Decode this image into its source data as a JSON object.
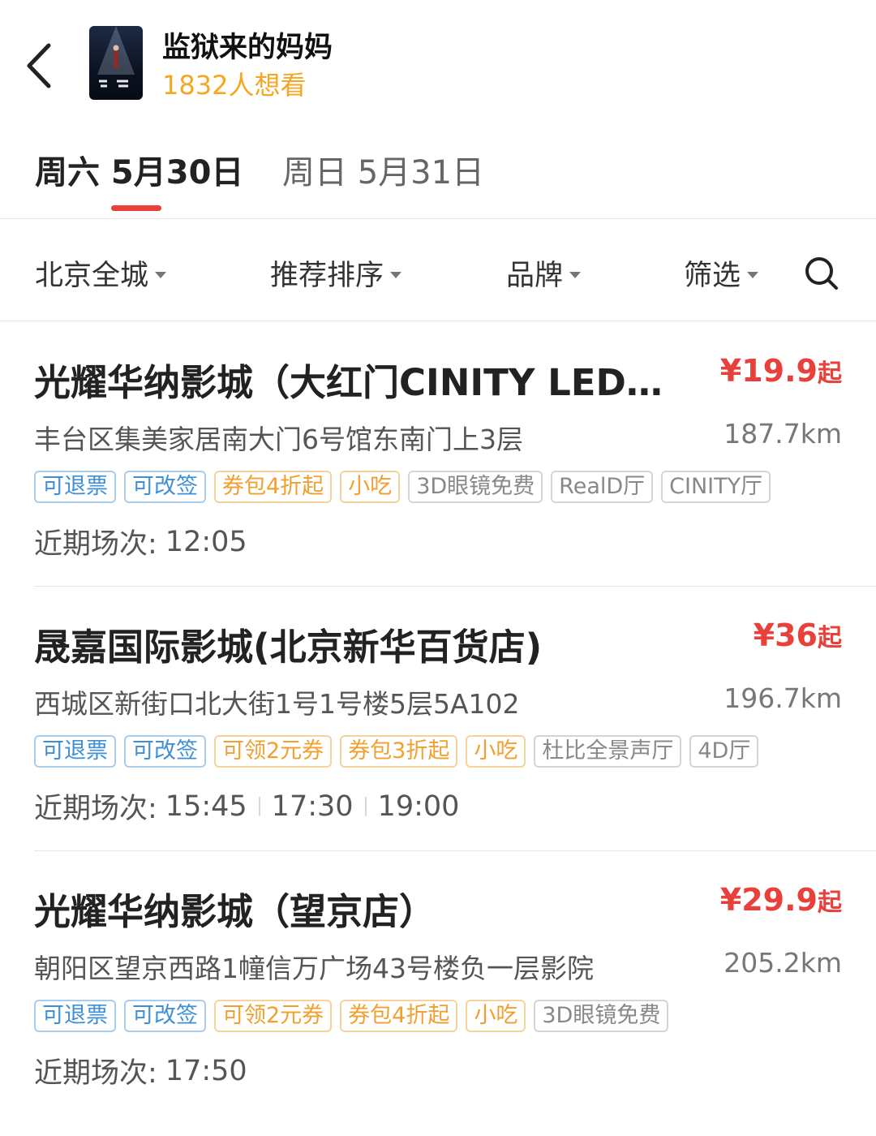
{
  "header": {
    "back_icon": "chevron-left-icon",
    "movie_title": "监狱来的妈妈",
    "want_count": "1832人想看"
  },
  "date_tabs": [
    {
      "label": "周六 5月30日",
      "active": true
    },
    {
      "label": "周日 5月31日",
      "active": false
    }
  ],
  "filters": {
    "city": "北京全城",
    "sort": "推荐排序",
    "brand": "品牌",
    "filter": "筛选",
    "search_icon": "search-icon"
  },
  "colors": {
    "accent_red": "#e8403a",
    "want_yellow": "#f5a623",
    "tag_blue": "#3e8fd6",
    "tag_orange": "#f0a030",
    "tag_grey": "#888888"
  },
  "cinemas": [
    {
      "name": "光耀华纳影城（大红门CINITY LED…",
      "price": "¥19.9",
      "price_suffix": "起",
      "address": "丰台区集美家居南大门6号馆东南门上3层",
      "distance": "187.7km",
      "tags": [
        "可退票",
        "可改签",
        "券包4折起",
        "小吃",
        "3D眼镜免费",
        "RealD厅",
        "CINITY厅"
      ],
      "sessions_label": "近期场次:",
      "sessions": [
        "12:05"
      ]
    },
    {
      "name": "晟嘉国际影城(北京新华百货店)",
      "price": "¥36",
      "price_suffix": "起",
      "address": "西城区新街口北大街1号1号楼5层5A102",
      "distance": "196.7km",
      "tags": [
        "可退票",
        "可改签",
        "可领2元券",
        "券包3折起",
        "小吃",
        "杜比全景声厅",
        "4D厅"
      ],
      "sessions_label": "近期场次:",
      "sessions": [
        "15:45",
        "17:30",
        "19:00"
      ]
    },
    {
      "name": "光耀华纳影城（望京店）",
      "price": "¥29.9",
      "price_suffix": "起",
      "address": "朝阳区望京西路1幢信万广场43号楼负一层影院",
      "distance": "205.2km",
      "tags": [
        "可退票",
        "可改签",
        "可领2元券",
        "券包4折起",
        "小吃",
        "3D眼镜免费"
      ],
      "sessions_label": "近期场次:",
      "sessions": [
        "17:50"
      ]
    }
  ]
}
